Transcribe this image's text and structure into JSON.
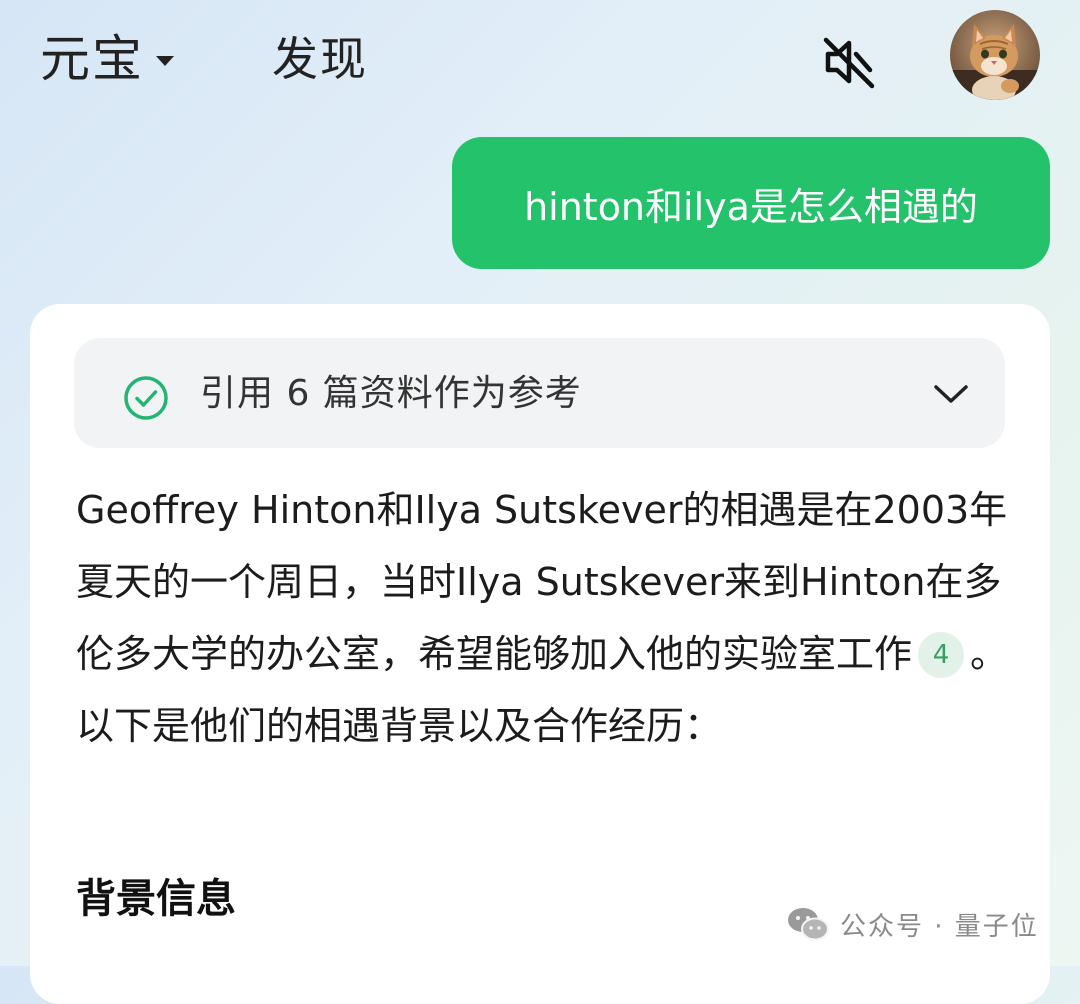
{
  "header": {
    "app_title": "元宝",
    "discover_label": "发现",
    "mute_icon": "speaker-muted-icon",
    "avatar_icon": "user-avatar-cat"
  },
  "conversation": {
    "user_message": "hinton和ilya是怎么相遇的",
    "references": {
      "label": "引用 6 篇资料作为参考",
      "check_icon": "check-circle-icon",
      "expand_icon": "chevron-down-icon"
    },
    "answer": {
      "text_before_citation": "Geoffrey Hinton和Ilya Sutskever的相遇是在2003年夏天的一个周日，当时Ilya Sutskever来到Hinton在多伦多大学的办公室，希望能够加入他的实验室工作",
      "citation_number": "4",
      "text_after_citation": "。以下是他们的相遇背景以及合作经历：",
      "section_heading": "背景信息"
    }
  },
  "watermark": {
    "text": "公众号 · 量子位",
    "icon": "wechat-icon"
  },
  "colors": {
    "user_bubble": "#23c26b",
    "check_green": "#22b573",
    "citation_bg": "#e3f2e8",
    "citation_text": "#3a9c66"
  }
}
